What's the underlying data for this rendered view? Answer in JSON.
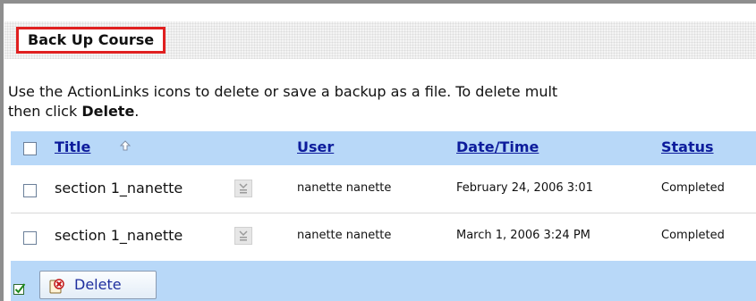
{
  "page": {
    "title": "Back Up Course"
  },
  "instructions": {
    "line1": "Use the ActionLinks icons to delete or save a backup as a file. To delete mult",
    "line2_prefix": "then click ",
    "line2_bold": "Delete",
    "line2_suffix": "."
  },
  "table": {
    "headers": {
      "title": "Title",
      "user": "User",
      "datetime": "Date/Time",
      "status": "Status"
    },
    "rows": [
      {
        "title": "section 1_nanette",
        "user": "nanette nanette",
        "datetime": "February 24, 2006 3:01",
        "status": "Completed"
      },
      {
        "title": "section 1_nanette",
        "user": "nanette nanette",
        "datetime": "March 1, 2006 3:24 PM",
        "status": "Completed"
      }
    ]
  },
  "footer": {
    "delete_label": "Delete"
  },
  "icons": {
    "sort": "sort-ascending-arrow-icon",
    "action": "actionlinks-icon",
    "check_all": "check-all-icon",
    "delete": "delete-icon"
  },
  "colors": {
    "highlight_border": "#e02020",
    "table_header_bg": "#b8d8f8",
    "link": "#0d1c9c"
  }
}
